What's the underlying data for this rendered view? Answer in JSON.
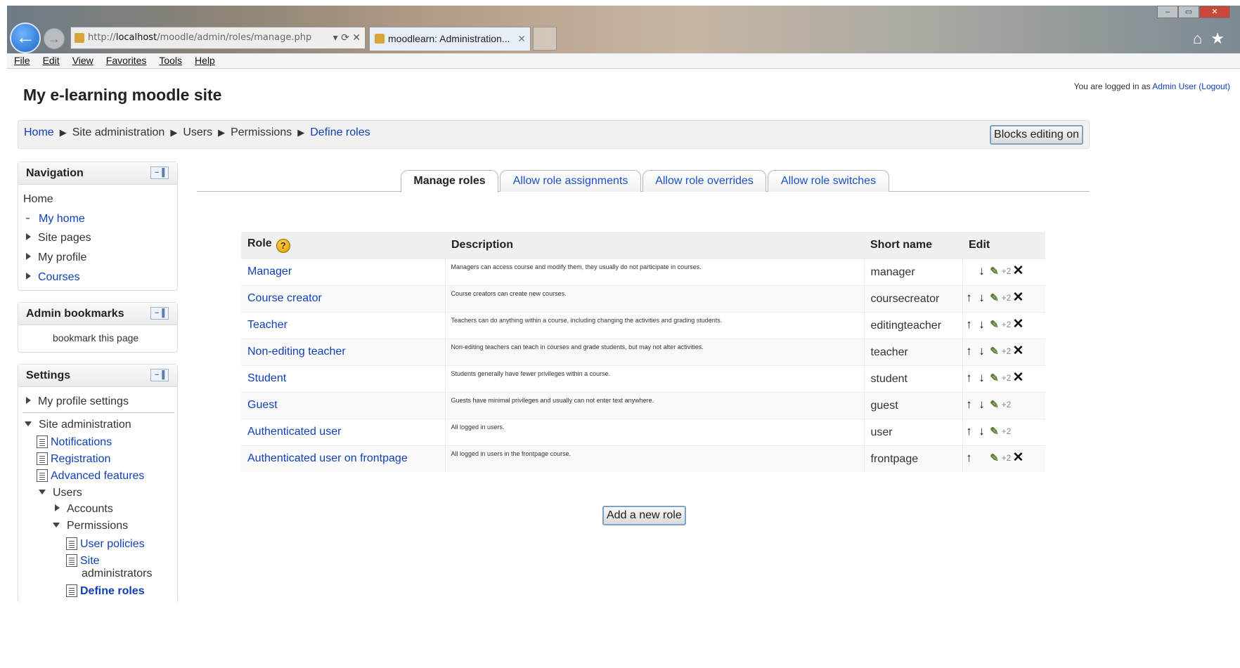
{
  "browser": {
    "address_prefix": "http://",
    "address_host": "localhost",
    "address_path": "/moodle/admin/roles/manage.php",
    "tab_title": "moodlearn: Administration...",
    "menu": [
      "File",
      "Edit",
      "View",
      "Favorites",
      "Tools",
      "Help"
    ]
  },
  "site": {
    "title": "My e-learning moodle site",
    "login_prefix": "You are logged in as ",
    "login_user": "Admin User",
    "logout": "(Logout)"
  },
  "breadcrumb": {
    "items": [
      "Home",
      "Site administration",
      "Users",
      "Permissions",
      "Define roles"
    ],
    "separator": "▶"
  },
  "editing_button": "Blocks editing on",
  "navigation": {
    "title": "Navigation",
    "home": "Home",
    "my_home": "My home",
    "site_pages": "Site pages",
    "my_profile": "My profile",
    "courses": "Courses"
  },
  "admin_bookmarks": {
    "title": "Admin bookmarks",
    "link": "bookmark this page"
  },
  "settings": {
    "title": "Settings",
    "my_profile_settings": "My profile settings",
    "site_admin": "Site administration",
    "notifications": "Notifications",
    "registration": "Registration",
    "advanced_features": "Advanced features",
    "users": "Users",
    "accounts": "Accounts",
    "permissions": "Permissions",
    "user_policies": "User policies",
    "site_admins_line1": "Site",
    "site_admins_line2": "administrators",
    "define_roles": "Define roles"
  },
  "tabs": [
    "Manage roles",
    "Allow role assignments",
    "Allow role overrides",
    "Allow role switches"
  ],
  "table": {
    "headers": [
      "Role",
      "Description",
      "Short name",
      "Edit"
    ],
    "help_icon": "?",
    "rows": [
      {
        "role": "Manager",
        "description": "Managers can access course and modify them, they usually do not participate in courses.",
        "short": "manager",
        "edit": [
          "",
          "down",
          "edit",
          "dup",
          "del"
        ]
      },
      {
        "role": "Course creator",
        "description": "Course creators can create new courses.",
        "short": "coursecreator",
        "edit": [
          "up",
          "down",
          "edit",
          "dup",
          "del"
        ]
      },
      {
        "role": "Teacher",
        "description": "Teachers can do anything within a course, including changing the activities and grading students.",
        "short": "editingteacher",
        "edit": [
          "up",
          "down",
          "edit",
          "dup",
          "del"
        ]
      },
      {
        "role": "Non-editing teacher",
        "description": "Non-editing teachers can teach in courses and grade students, but may not alter activities.",
        "short": "teacher",
        "edit": [
          "up",
          "down",
          "edit",
          "dup",
          "del"
        ]
      },
      {
        "role": "Student",
        "description": "Students generally have fewer privileges within a course.",
        "short": "student",
        "edit": [
          "up",
          "down",
          "edit",
          "dup",
          "del"
        ]
      },
      {
        "role": "Guest",
        "description": "Guests have minimal privileges and usually can not enter text anywhere.",
        "short": "guest",
        "edit": [
          "up",
          "down",
          "edit",
          "dup",
          ""
        ]
      },
      {
        "role": "Authenticated user",
        "description": "All logged in users.",
        "short": "user",
        "edit": [
          "up",
          "down",
          "edit",
          "dup",
          ""
        ]
      },
      {
        "role": "Authenticated user on frontpage",
        "description": "All logged in users in the frontpage course.",
        "short": "frontpage",
        "edit": [
          "up",
          "",
          "edit",
          "dup",
          "del"
        ]
      }
    ]
  },
  "icons": {
    "up": "↑",
    "down": "↓",
    "edit": "✎",
    "dup": "+2",
    "del": "✕"
  },
  "add_role_button": "Add a new role",
  "colors": {
    "link": "#0f3fb8",
    "header_bg": "#f0f0f0",
    "button_border": "#7da2c8"
  }
}
